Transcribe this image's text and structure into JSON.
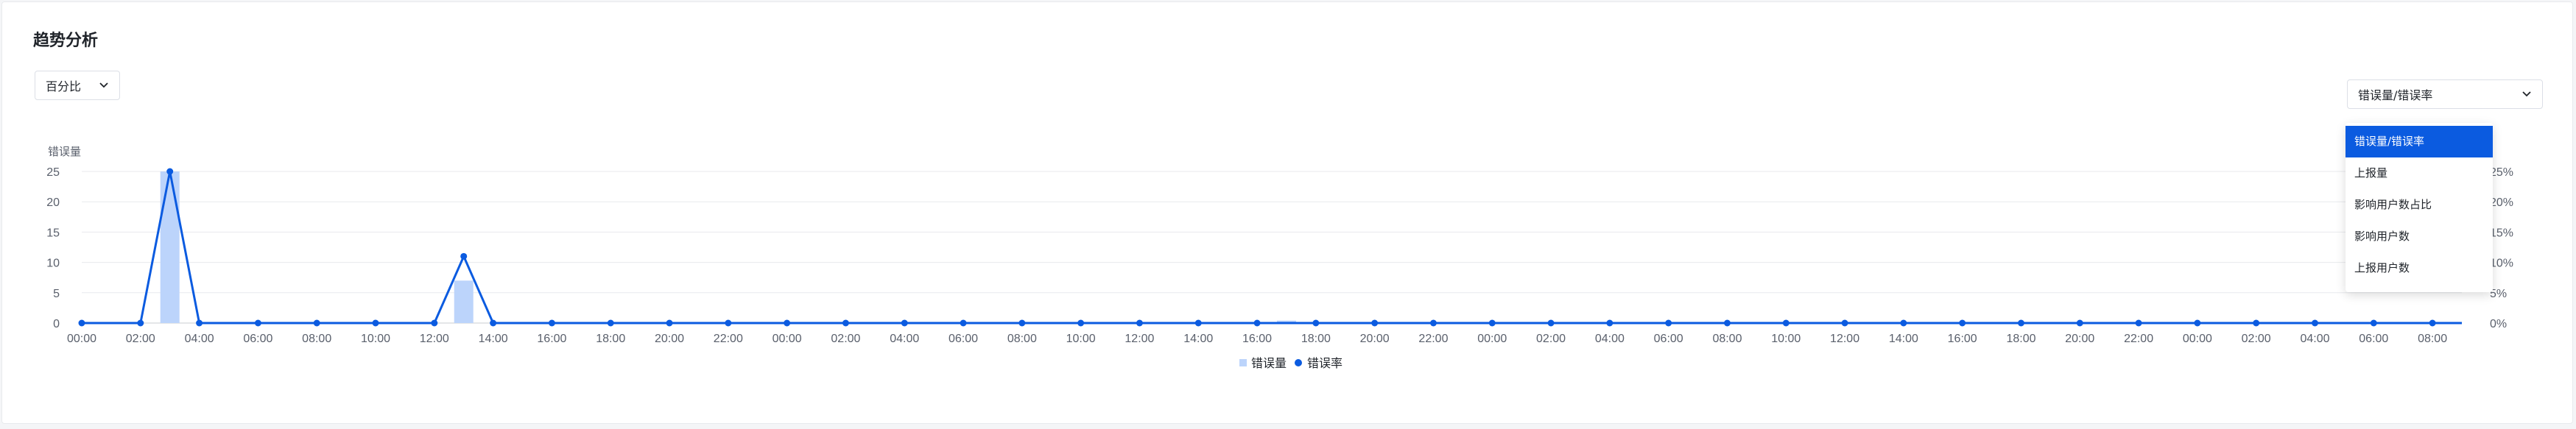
{
  "panel": {
    "title": "趋势分析",
    "mode_select": {
      "value": "百分比"
    },
    "metric_select": {
      "value": "错误量/错误率",
      "options": [
        "错误量/错误率",
        "上报量",
        "影响用户数占比",
        "影响用户数",
        "上报用户数"
      ],
      "selected_index": 0
    }
  },
  "colors": {
    "bar": "#bcd4fb",
    "line": "#0b5be0",
    "grid": "#e8eaed",
    "axis": "#595f6b"
  },
  "chart_data": {
    "type": "bar",
    "title": "",
    "ylabel_left": "错误量",
    "ylim_left": [
      0,
      25
    ],
    "yticks_left": [
      "0",
      "5",
      "10",
      "15",
      "20",
      "25"
    ],
    "yticks_right": [
      "0%",
      "5%",
      "10%",
      "15%",
      "20%",
      "25%"
    ],
    "ylim_right": [
      0,
      25
    ],
    "x_tick_labels": [
      "00:00",
      "02:00",
      "04:00",
      "06:00",
      "08:00",
      "10:00",
      "12:00",
      "14:00",
      "16:00",
      "18:00",
      "20:00",
      "22:00",
      "00:00",
      "02:00",
      "04:00",
      "06:00",
      "08:00",
      "10:00",
      "12:00",
      "14:00",
      "16:00",
      "18:00",
      "20:00",
      "22:00",
      "00:00",
      "02:00",
      "04:00",
      "06:00",
      "08:00",
      "10:00",
      "12:00",
      "14:00",
      "16:00",
      "18:00",
      "20:00",
      "22:00",
      "00:00",
      "02:00",
      "04:00",
      "06:00",
      "08:00"
    ],
    "hours": 81,
    "grid": true,
    "legend_position": "bottom-center",
    "series": [
      {
        "name": "错误量",
        "type": "bar",
        "axis": "left",
        "points": [
          {
            "h": 3,
            "v": 25
          },
          {
            "h": 13,
            "v": 7
          },
          {
            "h": 41,
            "v": 0.4
          }
        ]
      },
      {
        "name": "错误率",
        "type": "line",
        "axis": "right",
        "points": [
          {
            "h": 0,
            "v": 0
          },
          {
            "h": 2,
            "v": 0
          },
          {
            "h": 3,
            "v": 25
          },
          {
            "h": 4,
            "v": 0
          },
          {
            "h": 12,
            "v": 0
          },
          {
            "h": 13,
            "v": 11
          },
          {
            "h": 14,
            "v": 0
          },
          {
            "h": 81,
            "v": 0
          }
        ],
        "markers_every_hours": 2
      }
    ]
  }
}
